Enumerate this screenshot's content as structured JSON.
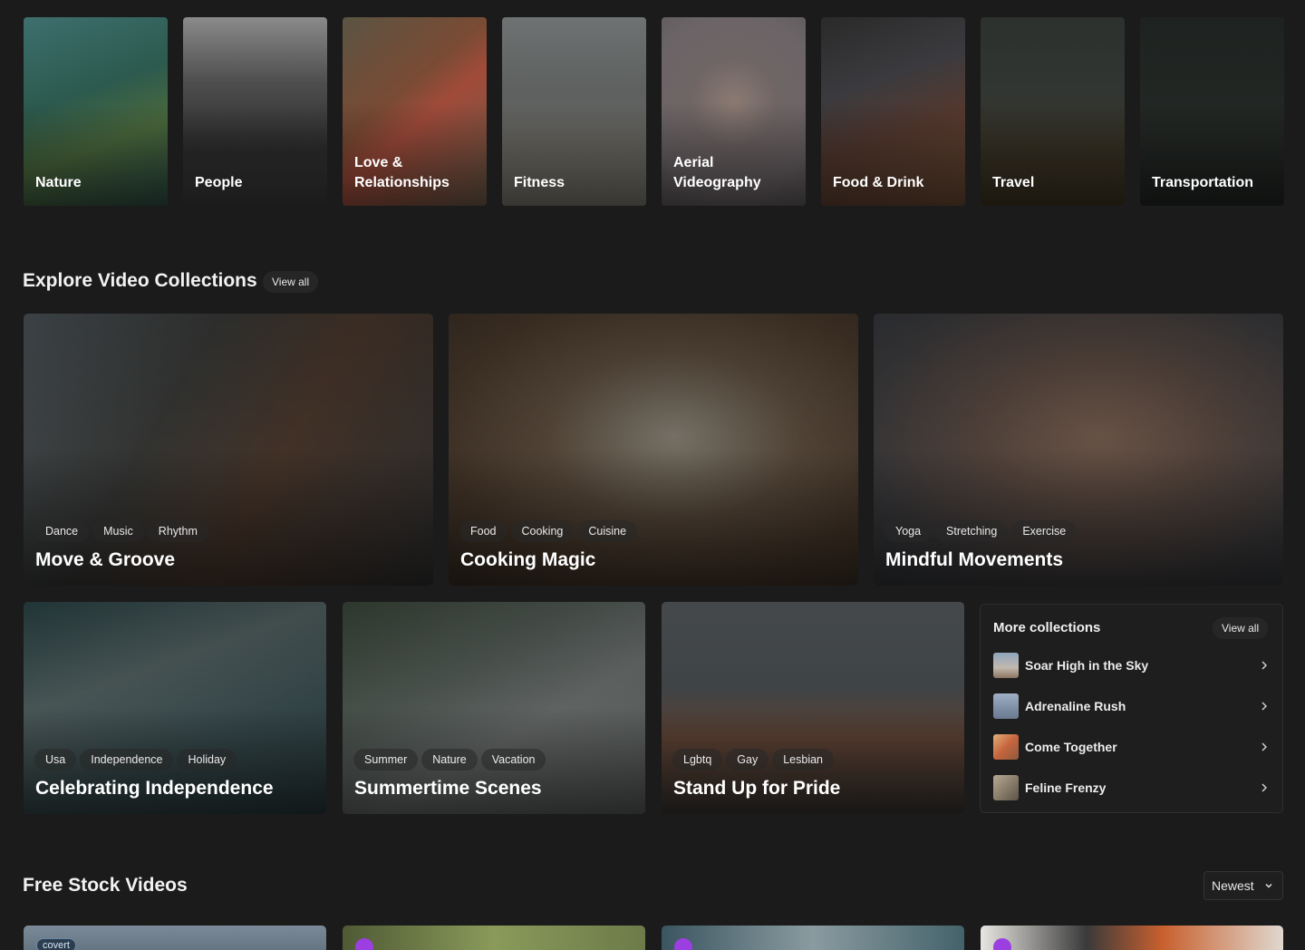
{
  "categories": [
    {
      "label": "Nature"
    },
    {
      "label": "People"
    },
    {
      "label": "Love &\nRelationships"
    },
    {
      "label": "Fitness"
    },
    {
      "label": "Aerial\nVideography"
    },
    {
      "label": "Food & Drink"
    },
    {
      "label": "Travel"
    },
    {
      "label": "Transportation"
    }
  ],
  "collections_section": {
    "title": "Explore Video Collections",
    "view_all": "View all"
  },
  "collections": [
    {
      "title": "Move & Groove",
      "tags": [
        "Dance",
        "Music",
        "Rhythm"
      ]
    },
    {
      "title": "Cooking Magic",
      "tags": [
        "Food",
        "Cooking",
        "Cuisine"
      ]
    },
    {
      "title": "Mindful Movements",
      "tags": [
        "Yoga",
        "Stretching",
        "Exercise"
      ]
    },
    {
      "title": "Celebrating Independence",
      "tags": [
        "Usa",
        "Independence",
        "Holiday"
      ]
    },
    {
      "title": "Summertime Scenes",
      "tags": [
        "Summer",
        "Nature",
        "Vacation"
      ]
    },
    {
      "title": "Stand Up for Pride",
      "tags": [
        "Lgbtq",
        "Gay",
        "Lesbian"
      ]
    }
  ],
  "more_collections": {
    "title": "More collections",
    "view_all": "View all",
    "items": [
      {
        "label": "Soar High in the Sky"
      },
      {
        "label": "Adrenaline Rush"
      },
      {
        "label": "Come Together"
      },
      {
        "label": "Feline Frenzy"
      }
    ]
  },
  "stock_section": {
    "title": "Free Stock Videos",
    "sort_selected": "Newest",
    "first_badge": "covert"
  }
}
